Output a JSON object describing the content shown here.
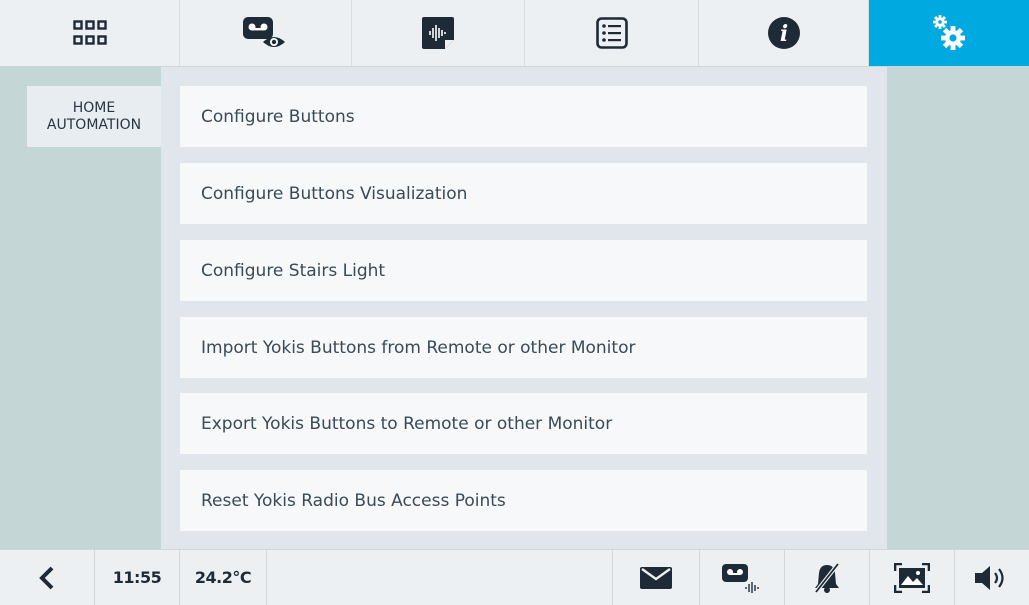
{
  "colors": {
    "accent": "#00a9e0",
    "icon": "#1e2a35"
  },
  "topbar": {
    "tabs": [
      {
        "icon": "apps-grid-icon"
      },
      {
        "icon": "video-message-eye-icon"
      },
      {
        "icon": "audio-message-icon"
      },
      {
        "icon": "list-icon"
      },
      {
        "icon": "info-icon"
      },
      {
        "icon": "settings-gears-icon",
        "active": true
      }
    ]
  },
  "sidebar": {
    "items": [
      {
        "label_line1": "HOME",
        "label_line2": "AUTOMATION"
      }
    ]
  },
  "menu": {
    "items": [
      {
        "label": "Configure Buttons"
      },
      {
        "label": "Configure Buttons Visualization"
      },
      {
        "label": "Configure Stairs Light"
      },
      {
        "label": "Import Yokis Buttons from Remote or other Monitor"
      },
      {
        "label": "Export Yokis Buttons to Remote or other Monitor"
      },
      {
        "label": "Reset Yokis Radio Bus Access Points"
      }
    ]
  },
  "statusbar": {
    "back_icon": "chevron-left-icon",
    "time": "11:55",
    "temperature": "24.2°C",
    "icons": [
      "envelope-icon",
      "voicemail-icon",
      "bell-off-icon",
      "picture-frame-icon",
      "speaker-icon"
    ]
  }
}
